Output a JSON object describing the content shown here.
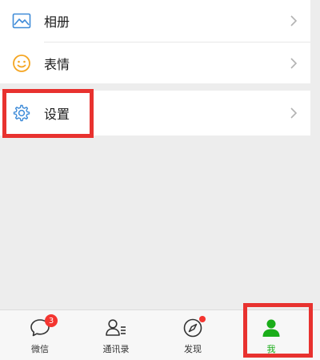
{
  "menu": {
    "items": [
      {
        "label": "相册",
        "icon": "photo-album-icon"
      },
      {
        "label": "表情",
        "icon": "smiley-icon"
      }
    ],
    "settings": {
      "label": "设置",
      "icon": "gear-icon"
    }
  },
  "tabbar": {
    "tabs": [
      {
        "label": "微信",
        "icon": "chat-bubble-icon",
        "badge": "3"
      },
      {
        "label": "通讯录",
        "icon": "contacts-icon"
      },
      {
        "label": "发现",
        "icon": "compass-icon",
        "dot": true
      },
      {
        "label": "我",
        "icon": "person-icon",
        "active": true
      }
    ]
  },
  "colors": {
    "accent_green": "#1aad19",
    "icon_blue": "#3e8bd8",
    "smiley_orange": "#f5a623",
    "highlight_red": "#e8322f",
    "badge_red": "#f43530"
  }
}
